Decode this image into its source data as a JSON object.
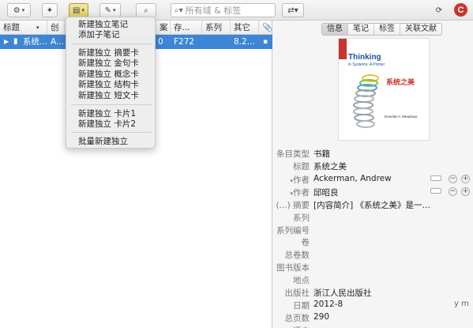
{
  "toolbar": {
    "search_placeholder": "所有域 & 标签"
  },
  "item_list": {
    "columns": [
      "标题",
      "创",
      "案",
      "存...",
      "系列",
      "其它"
    ],
    "row": {
      "title": "系统...",
      "creator": "A...",
      "col_c": "0",
      "col_d": "F272",
      "other": "8.2..."
    }
  },
  "new_item_menu": {
    "items": [
      "新建独立笔记",
      "添加子笔记",
      "新建独立 摘要卡",
      "新建独立 金句卡",
      "新建独立 概念卡",
      "新建独立 结构卡",
      "新建独立 短文卡",
      "新建独立 卡片1",
      "新建独立 卡片2",
      "批量新建独立"
    ]
  },
  "detail": {
    "tabs": [
      "信息",
      "笔记",
      "标签",
      "关联文献"
    ],
    "active_tab": "信息",
    "cover": {
      "title": "Thinking",
      "subtitle": "in Systems: A Primer",
      "cn_title": "系统之美",
      "author": "Donella H. Meadows"
    },
    "fields": [
      {
        "label": "条目类型",
        "value": "书籍"
      },
      {
        "label": "标题",
        "value": "系统之美"
      },
      {
        "label": "作者",
        "value": "Ackerman, Andrew"
      },
      {
        "label": "作者",
        "value": "邱昭良"
      },
      {
        "label": "(...) 摘要",
        "value": "[内容简介] 《系统之美》是一本简明扼..."
      },
      {
        "label": "系列",
        "value": ""
      },
      {
        "label": "系列编号",
        "value": ""
      },
      {
        "label": "卷",
        "value": ""
      },
      {
        "label": "总卷数",
        "value": ""
      },
      {
        "label": "图书版本",
        "value": ""
      },
      {
        "label": "地点",
        "value": ""
      },
      {
        "label": "出版社",
        "value": "浙江人民出版社"
      },
      {
        "label": "日期",
        "value": "2012-8"
      },
      {
        "label": "总页数",
        "value": "290"
      },
      {
        "label": "语言",
        "value": ""
      }
    ],
    "date_format": "y m"
  },
  "colors": {
    "selection": "#3d85d6",
    "accent_red": "#c9342c"
  }
}
